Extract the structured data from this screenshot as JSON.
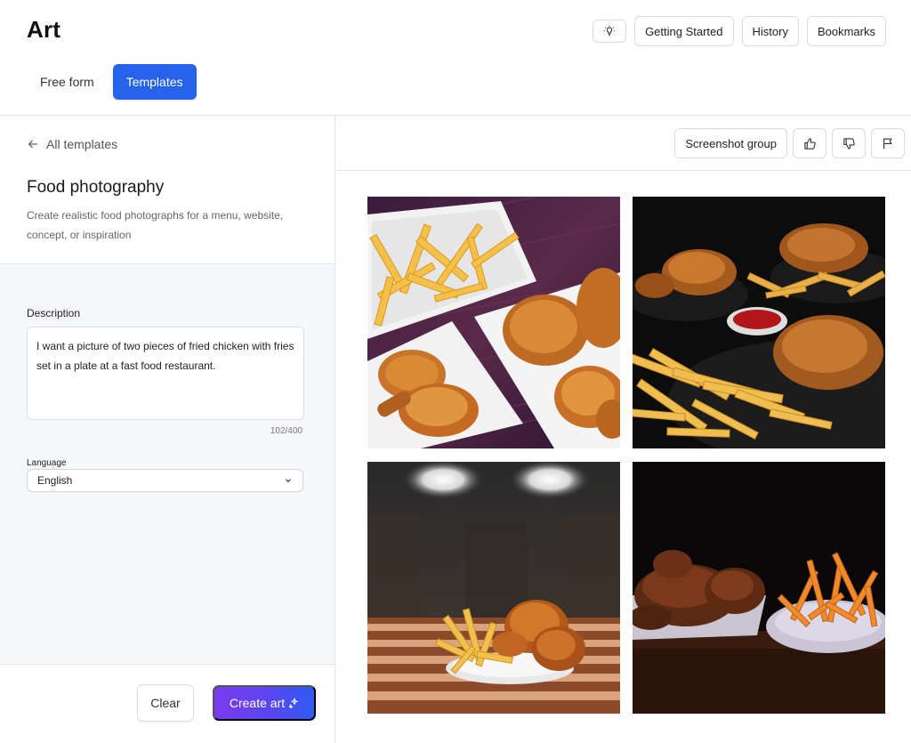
{
  "app": {
    "title": "Art"
  },
  "header": {
    "actions": [
      "Getting Started",
      "History",
      "Bookmarks"
    ],
    "tip_icon": "lightbulb-icon"
  },
  "mode_tabs": [
    {
      "label": "Free form",
      "active": false
    },
    {
      "label": "Templates",
      "active": true
    }
  ],
  "sidebar": {
    "back_label": "All templates",
    "template_title": "Food photography",
    "template_description": "Create realistic food photographs for a menu, website, concept, or inspiration",
    "description_label": "Description",
    "description_value": "I want a picture of  two pieces of fried chicken with fries set in a plate at a fast food restaurant.",
    "char_count": "102/400",
    "language_label": "Language",
    "language_value": "English",
    "clear_label": "Clear",
    "create_label": "Create art"
  },
  "results_toolbar": {
    "group_label": "Screenshot group",
    "icons": [
      "thumbs-up-icon",
      "thumbs-down-icon",
      "flag-icon"
    ]
  },
  "gallery": {
    "images": [
      {
        "subject": "fried-chicken-fries-white-plates"
      },
      {
        "subject": "fried-chicken-fries-dark-background"
      },
      {
        "subject": "fried-chicken-fries-restaurant-counter"
      },
      {
        "subject": "fried-chicken-fries-dark-table"
      }
    ]
  },
  "colors": {
    "accent": "#2563eb",
    "create_gradient_start": "#7c3aed",
    "create_gradient_end": "#2f5cf0",
    "panel_bg": "#f5f7fa"
  }
}
